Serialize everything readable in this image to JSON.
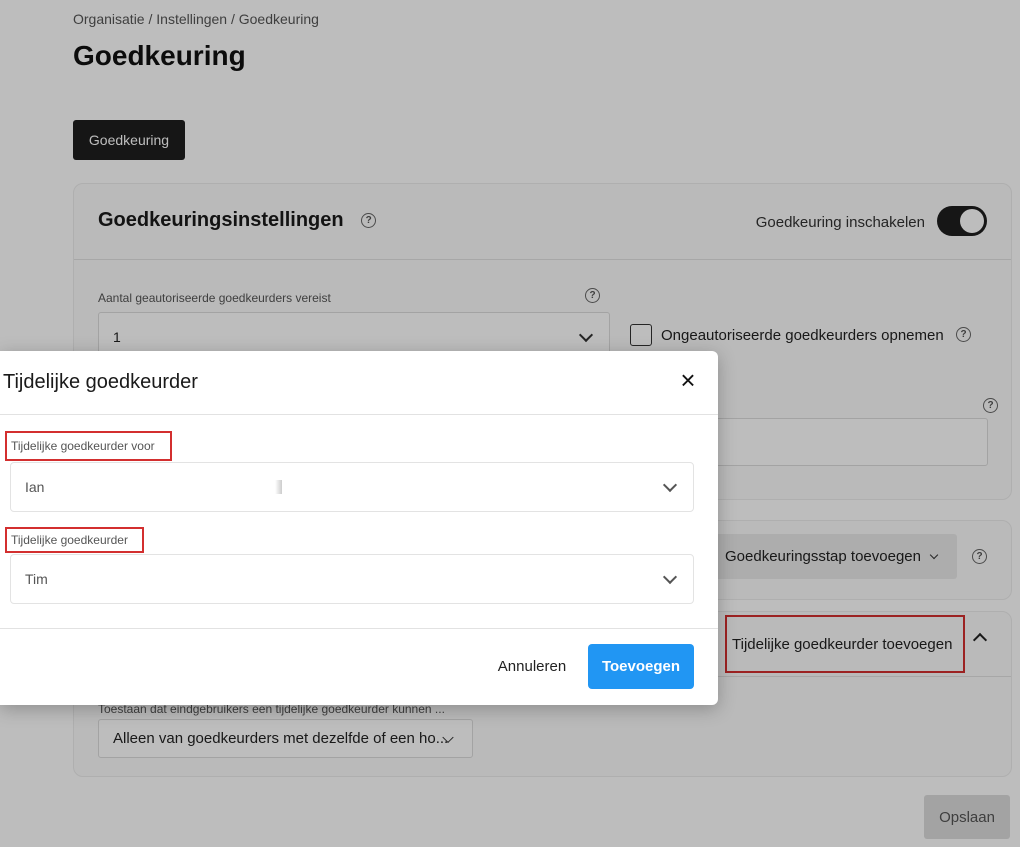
{
  "breadcrumb": "Organisatie / Instellingen / Goedkeuring",
  "page_title": "Goedkeuring",
  "tab": {
    "label": "Goedkeuring"
  },
  "settings": {
    "title": "Goedkeuringsinstellingen",
    "toggle_label": "Goedkeuring inschakelen",
    "toggle_on": true,
    "required_label": "Aantal geautoriseerde goedkeurders vereist",
    "required_value": "1",
    "unauth_label": "Ongeautoriseerde goedkeurders opnemen"
  },
  "steps": {
    "add_step_label": "Goedkeuringsstap toevoegen"
  },
  "temp": {
    "title": "Tijdelijke goedkeurder toevoegen",
    "allow_label": "Toestaan dat eindgebruikers een tijdelijke goedkeurder kunnen ...",
    "allow_value": "Alleen van goedkeurders met dezelfde of een ho..."
  },
  "save_label": "Opslaan",
  "modal": {
    "title": "Tijdelijke goedkeurder",
    "for_label": "Tijdelijke goedkeurder voor",
    "for_value": "Ian",
    "approver_label": "Tijdelijke goedkeurder",
    "approver_value": "Tim",
    "cancel_label": "Annuleren",
    "add_label": "Toevoegen"
  },
  "colors": {
    "primary": "#2196f3",
    "dark": "#1e1e1e",
    "highlight": "#d32f2f"
  }
}
